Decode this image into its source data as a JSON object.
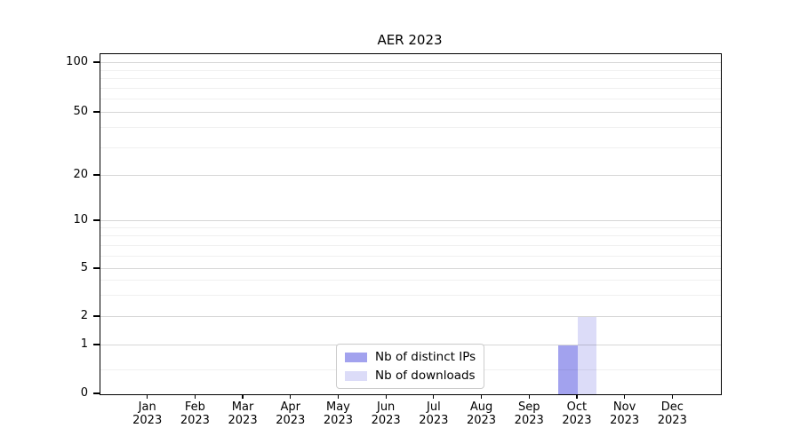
{
  "chart_data": {
    "type": "bar",
    "title": "AER 2023",
    "xlabel": "",
    "ylabel": "",
    "yscale": "symlog",
    "ylim": [
      0,
      110
    ],
    "grid": true,
    "legend_position": "lower-center",
    "categories": [
      {
        "month": "Jan",
        "year": "2023"
      },
      {
        "month": "Feb",
        "year": "2023"
      },
      {
        "month": "Mar",
        "year": "2023"
      },
      {
        "month": "Apr",
        "year": "2023"
      },
      {
        "month": "May",
        "year": "2023"
      },
      {
        "month": "Jun",
        "year": "2023"
      },
      {
        "month": "Jul",
        "year": "2023"
      },
      {
        "month": "Aug",
        "year": "2023"
      },
      {
        "month": "Sep",
        "year": "2023"
      },
      {
        "month": "Oct",
        "year": "2023"
      },
      {
        "month": "Nov",
        "year": "2023"
      },
      {
        "month": "Dec",
        "year": "2023"
      }
    ],
    "series": [
      {
        "name": "Nb of distinct IPs",
        "color": "#a2a2ee",
        "values": [
          0,
          0,
          0,
          0,
          0,
          0,
          0,
          0,
          0,
          1,
          0,
          0
        ]
      },
      {
        "name": "Nb of downloads",
        "color": "#dcdcf8",
        "values": [
          0,
          0,
          0,
          0,
          0,
          0,
          0,
          0,
          0,
          2,
          0,
          0
        ]
      }
    ],
    "y_ticks": [
      {
        "label": "0",
        "value": 0,
        "frac": 0
      },
      {
        "label": "1",
        "value": 1,
        "frac": 0.1436
      },
      {
        "label": "2",
        "value": 2,
        "frac": 0.2272
      },
      {
        "label": "5",
        "value": 5,
        "frac": 0.3681
      },
      {
        "label": "10",
        "value": 10,
        "frac": 0.5091
      },
      {
        "label": "20",
        "value": 20,
        "frac": 0.6423
      },
      {
        "label": "50",
        "value": 50,
        "frac": 0.8277
      },
      {
        "label": "100",
        "value": 100,
        "frac": 0.9739
      }
    ],
    "y_minor_fracs": [
      0.0718,
      0.2896,
      0.3339,
      0.4052,
      0.4365,
      0.4636,
      0.4877,
      0.7243,
      0.7825,
      0.8659,
      0.8987,
      0.9269,
      0.9517
    ]
  },
  "legend": {
    "items": [
      {
        "label": "Nb of distinct IPs",
        "color": "#a2a2ee"
      },
      {
        "label": "Nb of downloads",
        "color": "#dcdcf8"
      }
    ]
  }
}
